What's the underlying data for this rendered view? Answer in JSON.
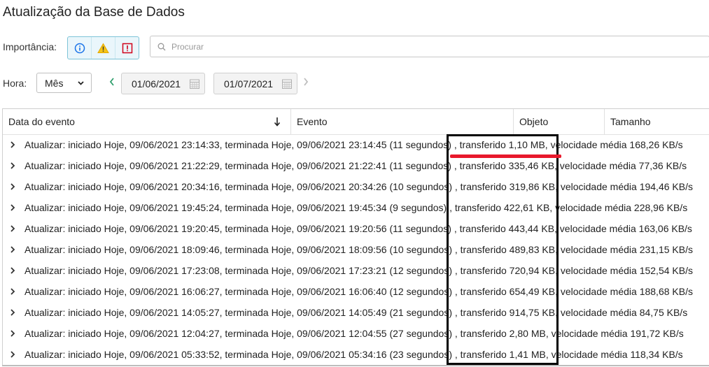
{
  "page": {
    "title": "Atualização da Base de Dados"
  },
  "filters": {
    "importance_label": "Importância:",
    "importance_buttons": [
      {
        "name": "info",
        "icon": "info-icon",
        "color": "#1a73e8"
      },
      {
        "name": "warning",
        "icon": "warning-icon",
        "color": "#e6a800"
      },
      {
        "name": "error",
        "icon": "error-icon",
        "color": "#d0021b"
      }
    ],
    "search_placeholder": "Procurar"
  },
  "time": {
    "label": "Hora:",
    "period": "Mês",
    "start_date": "01/06/2021",
    "end_date": "01/07/2021"
  },
  "table": {
    "columns": [
      "Data do evento",
      "Evento",
      "Objeto",
      "Tamanho"
    ],
    "sort_column": "Data do evento",
    "sort_direction": "descending",
    "rows": [
      "Atualizar: iniciado Hoje, 09/06/2021 23:14:33, terminada Hoje, 09/06/2021 23:14:45 (11 segundos) , transferido 1,10 MB, velocidade média 168,26 KB/s",
      "Atualizar: iniciado Hoje, 09/06/2021 21:22:29, terminada Hoje, 09/06/2021 21:22:41 (11 segundos) , transferido 335,46 KB, velocidade média 77,36 KB/s",
      "Atualizar: iniciado Hoje, 09/06/2021 20:34:16, terminada Hoje, 09/06/2021 20:34:26 (10 segundos) , transferido 319,86 KB, velocidade média 194,46 KB/s",
      "Atualizar: iniciado Hoje, 09/06/2021 19:45:24, terminada Hoje, 09/06/2021 19:45:34 (9 segundos) , transferido 422,61 KB, velocidade média 228,96 KB/s",
      "Atualizar: iniciado Hoje, 09/06/2021 19:20:45, terminada Hoje, 09/06/2021 19:20:56 (11 segundos) , transferido 443,44 KB, velocidade média 163,06 KB/s",
      "Atualizar: iniciado Hoje, 09/06/2021 18:09:46, terminada Hoje, 09/06/2021 18:09:56 (10 segundos) , transferido 489,83 KB, velocidade média 231,15 KB/s",
      "Atualizar: iniciado Hoje, 09/06/2021 17:23:08, terminada Hoje, 09/06/2021 17:23:21 (12 segundos) , transferido 720,94 KB, velocidade média 152,54 KB/s",
      "Atualizar: iniciado Hoje, 09/06/2021 16:06:27, terminada Hoje, 09/06/2021 16:06:40 (12 segundos) , transferido 654,49 KB, velocidade média 188,68 KB/s",
      "Atualizar: iniciado Hoje, 09/06/2021 14:05:27, terminada Hoje, 09/06/2021 14:05:49 (21 segundos) , transferido 914,75 KB, velocidade média 84,75 KB/s",
      "Atualizar: iniciado Hoje, 09/06/2021 12:04:27, terminada Hoje, 09/06/2021 12:04:55 (27 segundos) , transferido 2,80 MB, velocidade média 191,72 KB/s",
      "Atualizar: iniciado Hoje, 09/06/2021 05:33:52, terminada Hoje, 09/06/2021 05:34:16 (23 segundos) , transferido 1,41 MB, velocidade média 118,34 KB/s"
    ]
  },
  "annotations": {
    "highlight_box_color": "#000000",
    "underline_color": "#e8192c"
  }
}
